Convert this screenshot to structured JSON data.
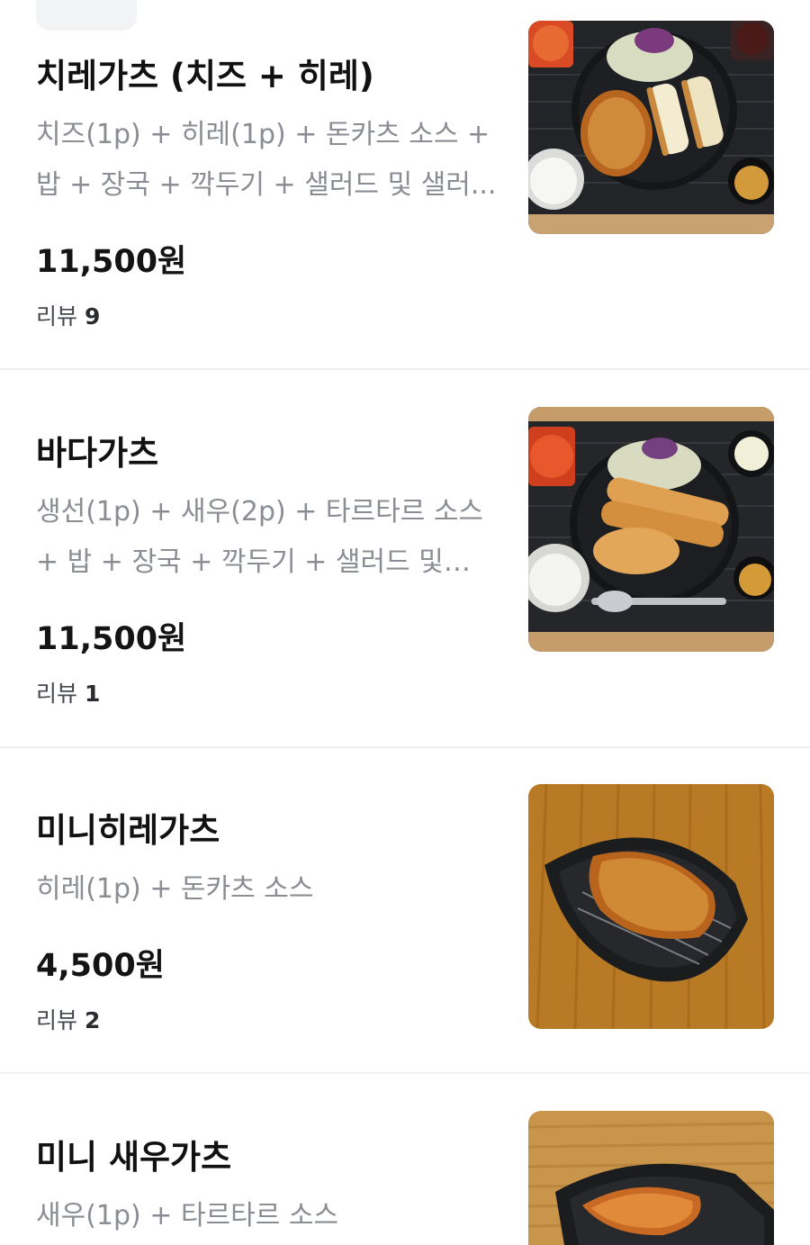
{
  "menu": {
    "items": [
      {
        "name": "치레가츠 (치즈 + 히레)",
        "description": "치즈(1p) + 히레(1p) + 돈카츠 소스 + 밥 + 장국 + 깍두기 + 샐러드 및 샐러...",
        "price": "11,500원",
        "review_label": "리뷰",
        "review_count": "9",
        "image_icon": "cheese-hire-katsu-set-photo"
      },
      {
        "name": "바다가츠",
        "description": "생선(1p) + 새우(2p) + 타르타르 소스 + 밥 + 장국 + 깍두기 + 샐러드 및 샐...",
        "price": "11,500원",
        "review_label": "리뷰",
        "review_count": "1",
        "image_icon": "seafood-katsu-set-photo"
      },
      {
        "name": "미니히레가츠",
        "description": "히레(1p) + 돈카츠 소스",
        "price": "4,500원",
        "review_label": "리뷰",
        "review_count": "2",
        "image_icon": "mini-hire-katsu-photo"
      },
      {
        "name": "미니 새우가츠",
        "description": "새우(1p) + 타르타르 소스",
        "image_icon": "mini-shrimp-katsu-photo"
      }
    ]
  }
}
